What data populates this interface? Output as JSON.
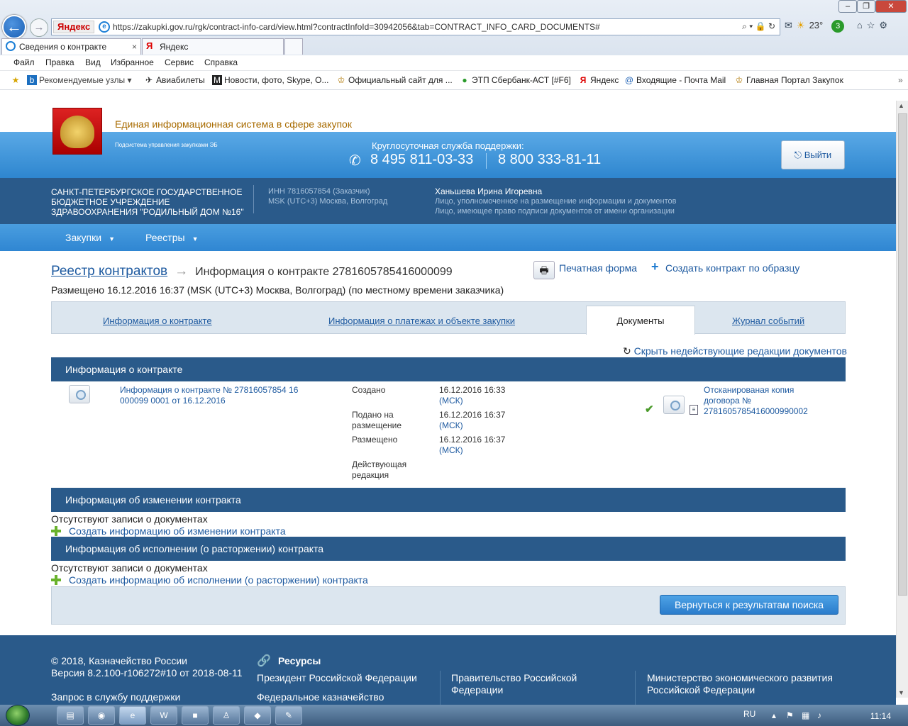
{
  "browser": {
    "url": "https://zakupki.gov.ru/rgk/contract-info-card/view.html?contractInfoId=30942056&tab=CONTRACT_INFO_CARD_DOCUMENTS#",
    "search_badge": "Яндекс",
    "weather": "23°",
    "notify_count": "3",
    "tabs": [
      {
        "label": "Сведения о контракте",
        "close": "×"
      },
      {
        "label": "Яндекс"
      }
    ],
    "menu": [
      "Файл",
      "Правка",
      "Вид",
      "Избранное",
      "Сервис",
      "Справка"
    ],
    "favorites": [
      "Рекомендуемые узлы ▾",
      "Авиабилеты",
      "Новости, фото, Skype, О...",
      "Официальный сайт для ...",
      "ЭТП Сбербанк-АСТ [#F6]",
      "Яндекс",
      "Входящие - Почта Mail",
      "Главная Портал Закупок"
    ]
  },
  "header": {
    "title": "Единая информационная система в сфере закупок",
    "subsystem": "Подсистема управления закупками ЭБ",
    "support_label": "Круглосуточная служба поддержки:",
    "phone1": "8 495 811-03-33",
    "phone2": "8 800 333-81-11",
    "logout": "Выйти"
  },
  "org": {
    "name": "САНКТ-ПЕТЕРБУРГСКОЕ ГОСУДАРСТВЕННОЕ БЮДЖЕТНОЕ УЧРЕЖДЕНИЕ ЗДРАВООХРАНЕНИЯ \"РОДИЛЬНЫЙ ДОМ №16\"",
    "inn": "ИНН 7816057854 (Заказчик)",
    "tz": "MSK (UTC+3) Москва, Волгоград",
    "user": "Ханьшева Ирина Игоревна",
    "role1": "Лицо, уполномоченное на размещение информации и документов",
    "role2": "Лицо, имеющее право подписи документов от имени организации"
  },
  "nav": {
    "purchases": "Закупки",
    "registries": "Реестры"
  },
  "breadcrumb": {
    "link": "Реестр контрактов",
    "arrow": "→",
    "current": "Информация о контракте 2781605785416000099"
  },
  "actions": {
    "print": "Печатная форма",
    "create": "Создать контракт по образцу"
  },
  "posted": "Размещено 16.12.2016 16:37 (MSK (UTC+3) Москва, Волгоград) (по местному времени заказчика)",
  "tabs": {
    "info": "Информация о контракте",
    "payments": "Информация о платежах и объекте закупки",
    "docs": "Документы",
    "journal": "Журнал событий"
  },
  "hide_link": "Скрыть недействующие редакции документов",
  "section1": {
    "title": "Информация о контракте",
    "doc_link": "Информация о контракте № 27816057854 16 000099 0001 от 16.12.2016",
    "created_label": "Создано",
    "created_value": "16.12.2016 16:33",
    "submitted_label": "Подано на размещение",
    "submitted_value": "16.12.2016 16:37",
    "placed_label": "Размещено",
    "placed_value": "16.12.2016 16:37",
    "tz_short": "(МСК)",
    "current_label": "Действующая редакция",
    "scan_link": "Отсканированая копия договора № 2781605785416000990002"
  },
  "section2": {
    "title": "Информация об изменении контракта",
    "empty": "Отсутствуют записи о документах",
    "add": "Создать информацию об изменении контракта"
  },
  "section3": {
    "title": "Информация об исполнении (о расторжении) контракта",
    "empty": "Отсутствуют записи о документах",
    "add": "Создать информацию об исполнении (о расторжении) контракта"
  },
  "return_button": "Вернуться к результатам поиска",
  "footer": {
    "copyright": "© 2018, Казначейство России",
    "version": "Версия 8.2.100-r106272#10 от 2018-08-11",
    "support_request": "Запрос в службу поддержки",
    "resources": "Ресурсы",
    "links": [
      "Президент Российской Федерации",
      "Федеральное казначейство",
      "Правительство Российской Федерации",
      "Министерство экономического развития Российской Федерации"
    ]
  },
  "taskbar": {
    "lang": "RU",
    "clock": "11:14"
  }
}
